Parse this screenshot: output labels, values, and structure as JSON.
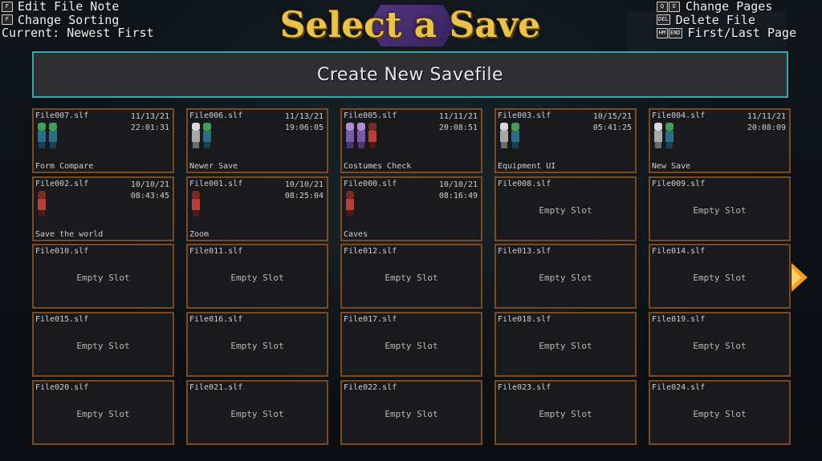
{
  "hints_left": [
    {
      "key": "F",
      "label": "Edit File Note",
      "icon": "function-key-icon"
    },
    {
      "key": "F",
      "label": "Change Sorting",
      "icon": "function-key-icon"
    }
  ],
  "current_sort": "Current: Newest First",
  "hints_right": [
    {
      "keys": [
        "Q",
        "E"
      ],
      "label": "Change Pages"
    },
    {
      "keys": [
        "DEL"
      ],
      "label": "Delete File"
    },
    {
      "keys": [
        "HM",
        "END"
      ],
      "label": "First/Last Page"
    }
  ],
  "title": "Select a Save",
  "create_button": "Create New Savefile",
  "empty_label": "Empty Slot",
  "colors": {
    "title": "#e8c24a",
    "create_border": "#3aa6b0",
    "slot_border": "#7a4a24",
    "arrow": "#f0a020"
  },
  "slots": [
    {
      "name": "File007.slf",
      "date": "11/13/21",
      "time": "22:01:31",
      "note": "Form Compare",
      "chars": [
        "green",
        "green"
      ]
    },
    {
      "name": "File006.slf",
      "date": "11/13/21",
      "time": "19:06:05",
      "note": "Newer Save",
      "chars": [
        "white",
        "green"
      ]
    },
    {
      "name": "File005.slf",
      "date": "11/11/21",
      "time": "20:08:51",
      "note": "Costumes Check",
      "chars": [
        "purple",
        "purple",
        "red"
      ]
    },
    {
      "name": "File003.slf",
      "date": "10/15/21",
      "time": "05:41:25",
      "note": "Equipment UI",
      "chars": [
        "white",
        "green"
      ]
    },
    {
      "name": "File004.slf",
      "date": "11/11/21",
      "time": "20:08:09",
      "note": "New Save",
      "chars": [
        "white",
        "green"
      ]
    },
    {
      "name": "File002.slf",
      "date": "10/10/21",
      "time": "08:43:45",
      "note": "Save the world",
      "chars": [
        "red"
      ]
    },
    {
      "name": "File001.slf",
      "date": "10/10/21",
      "time": "08:25:04",
      "note": "Zoom",
      "chars": [
        "red"
      ]
    },
    {
      "name": "File000.slf",
      "date": "10/10/21",
      "time": "08:16:49",
      "note": "Caves",
      "chars": [
        "red"
      ]
    },
    {
      "name": "File008.slf"
    },
    {
      "name": "File009.slf"
    },
    {
      "name": "File010.slf"
    },
    {
      "name": "File011.slf"
    },
    {
      "name": "File012.slf"
    },
    {
      "name": "File013.slf"
    },
    {
      "name": "File014.slf"
    },
    {
      "name": "File015.slf"
    },
    {
      "name": "File016.slf"
    },
    {
      "name": "File017.slf"
    },
    {
      "name": "File018.slf"
    },
    {
      "name": "File019.slf"
    },
    {
      "name": "File020.slf"
    },
    {
      "name": "File021.slf"
    },
    {
      "name": "File022.slf"
    },
    {
      "name": "File023.slf"
    },
    {
      "name": "File024.slf"
    }
  ]
}
